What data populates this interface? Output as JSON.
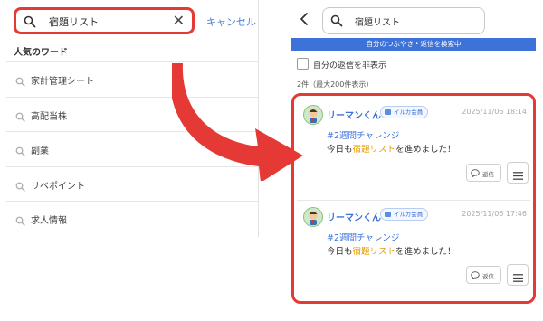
{
  "left_panel": {
    "search": {
      "value": "宿題リスト"
    },
    "cancel_label": "キャンセル",
    "popular_heading": "人気のワード",
    "popular_words": [
      "家計管理シート",
      "高配当株",
      "副業",
      "リベポイント",
      "求人情報"
    ]
  },
  "right_panel": {
    "search": {
      "value": "宿題リスト"
    },
    "scope_banner": "自分のつぶやき・返信を検索中",
    "hide_own_replies_label": "自分の返信を非表示",
    "hide_own_replies_checked": false,
    "result_count": "2件（最大200件表示）",
    "posts": [
      {
        "author": "リーマンくん",
        "badge": "イルカ会員",
        "timestamp": "2025/11/06 18:14",
        "hashtag": "#2週間チャレンジ",
        "text_before": "今日も",
        "text_highlight": "宿題リスト",
        "text_after": "を進めました！",
        "reply_label": "返信"
      },
      {
        "author": "リーマンくん",
        "badge": "イルカ会員",
        "timestamp": "2025/11/06 17:46",
        "hashtag": "#2週間チャレンジ",
        "text_before": "今日も",
        "text_highlight": "宿題リスト",
        "text_after": "を進めました！",
        "reply_label": "返信"
      }
    ]
  },
  "colors": {
    "highlight_red": "#e53935",
    "accent_blue": "#3d72d9",
    "keyword_orange": "#e89b00"
  },
  "icons": [
    "search-icon",
    "close-icon",
    "back-chevron-icon",
    "speech-bubble-icon",
    "hamburger-menu-icon",
    "dolphin-badge-icon",
    "avatar-icon",
    "arrow-annotation"
  ]
}
